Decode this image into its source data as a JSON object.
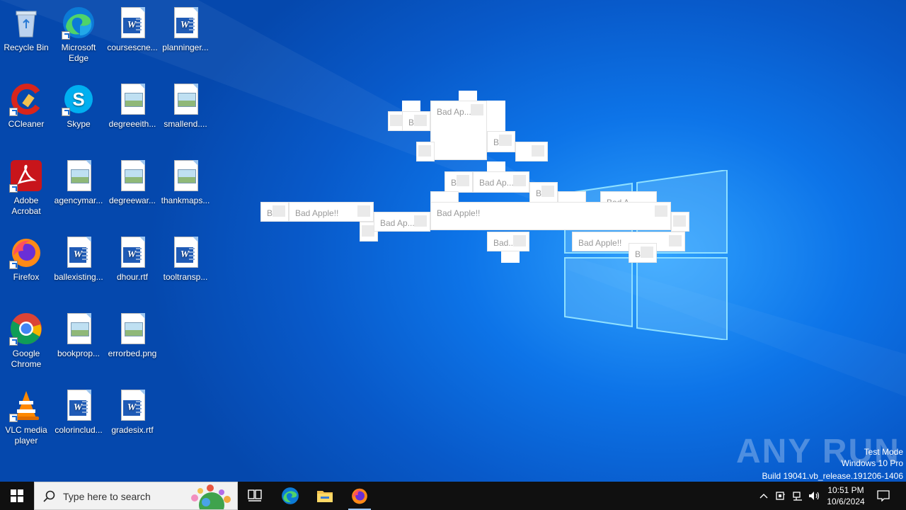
{
  "desktop": {
    "icons": [
      {
        "label": "Recycle Bin"
      },
      {
        "label": "Microsoft Edge"
      },
      {
        "label": "coursescne..."
      },
      {
        "label": "planninger..."
      },
      {
        "label": "CCleaner"
      },
      {
        "label": "Skype"
      },
      {
        "label": "degreeeith..."
      },
      {
        "label": "smallend...."
      },
      {
        "label": "Adobe Acrobat"
      },
      {
        "label": "agencymar..."
      },
      {
        "label": "degreewar..."
      },
      {
        "label": "thankmaps..."
      },
      {
        "label": "Firefox"
      },
      {
        "label": "ballexisting..."
      },
      {
        "label": "dhour.rtf"
      },
      {
        "label": "tooltransp..."
      },
      {
        "label": "Google Chrome"
      },
      {
        "label": "bookprop..."
      },
      {
        "label": "errorbed.png"
      },
      {
        "label": "VLC media player"
      },
      {
        "label": "colorinclud..."
      },
      {
        "label": "gradesix.rtf"
      }
    ]
  },
  "bad_apple": {
    "t_full": "Bad Apple!!",
    "t_ap": "Bad Ap...",
    "t_bad": "Bad...",
    "t_b": "B...",
    "t_b2": "B.",
    "t_ba": "Bad A..."
  },
  "watermark": {
    "brand": "ANY RUN",
    "line1": "Test Mode",
    "line2": "Windows 10 Pro",
    "line3": "Build 19041.vb_release.191206-1406"
  },
  "taskbar": {
    "search_placeholder": "Type here to search",
    "time": "10:51 PM",
    "date": "10/6/2024"
  }
}
